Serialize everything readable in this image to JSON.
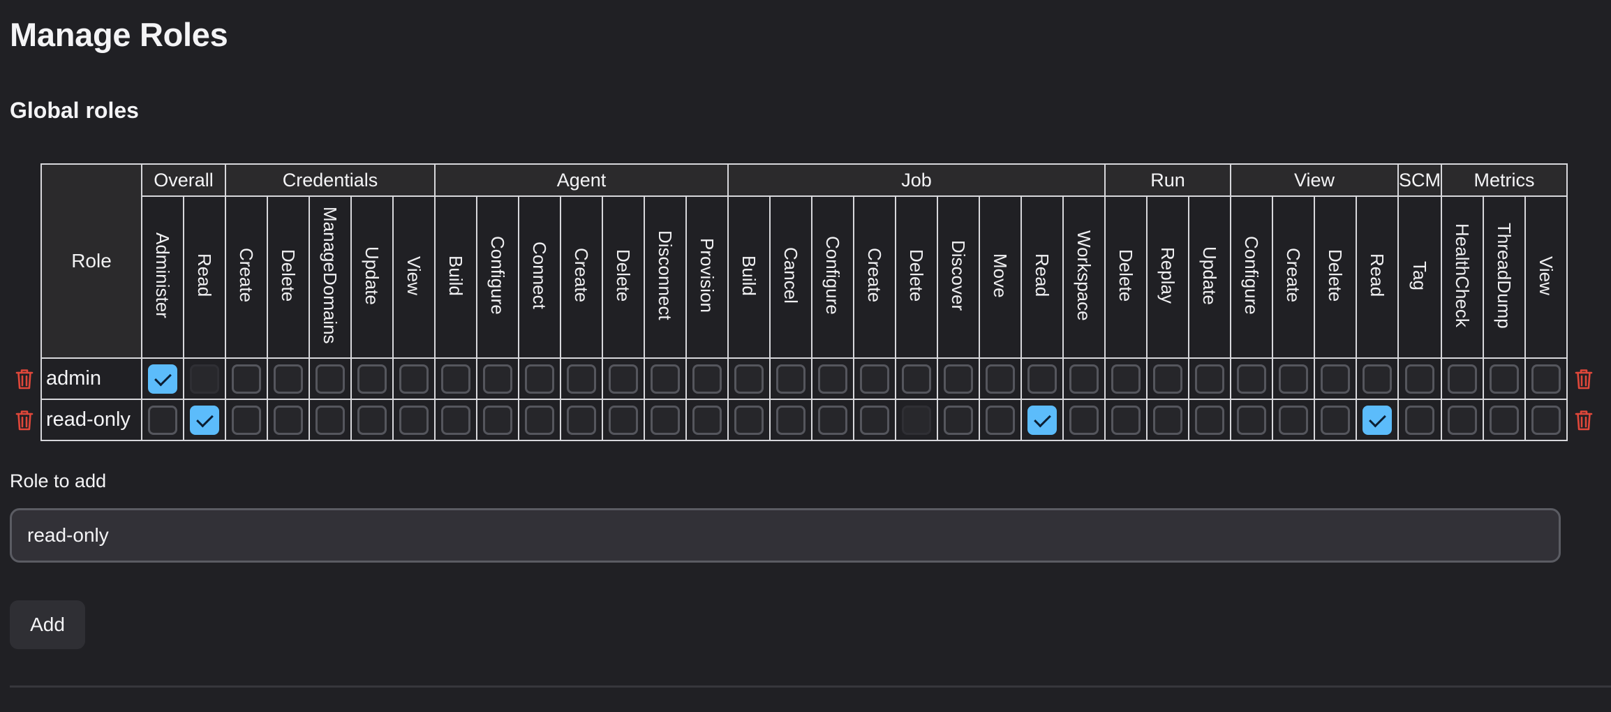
{
  "page": {
    "title": "Manage Roles",
    "section_title": "Global roles"
  },
  "table": {
    "role_header": "Role",
    "groups": [
      {
        "label": "Overall",
        "permissions": [
          "Administer",
          "Read"
        ]
      },
      {
        "label": "Credentials",
        "permissions": [
          "Create",
          "Delete",
          "ManageDomains",
          "Update",
          "View"
        ]
      },
      {
        "label": "Agent",
        "permissions": [
          "Build",
          "Configure",
          "Connect",
          "Create",
          "Delete",
          "Disconnect",
          "Provision"
        ]
      },
      {
        "label": "Job",
        "permissions": [
          "Build",
          "Cancel",
          "Configure",
          "Create",
          "Delete",
          "Discover",
          "Move",
          "Read",
          "Workspace"
        ]
      },
      {
        "label": "Run",
        "permissions": [
          "Delete",
          "Replay",
          "Update"
        ]
      },
      {
        "label": "View",
        "permissions": [
          "Configure",
          "Create",
          "Delete",
          "Read"
        ]
      },
      {
        "label": "SCM",
        "permissions": [
          "Tag"
        ]
      },
      {
        "label": "Metrics",
        "permissions": [
          "HealthCheck",
          "ThreadDump",
          "View"
        ]
      }
    ],
    "rows": [
      {
        "name": "admin",
        "checked": [
          1,
          0,
          0,
          0,
          0,
          0,
          0,
          0,
          0,
          0,
          0,
          0,
          0,
          0,
          0,
          0,
          0,
          0,
          0,
          0,
          0,
          0,
          0,
          0,
          0,
          0,
          0,
          0,
          0,
          0,
          0,
          0,
          0,
          0
        ],
        "dimmed": [
          0,
          1,
          0,
          0,
          0,
          0,
          0,
          0,
          0,
          0,
          0,
          0,
          0,
          0,
          0,
          0,
          0,
          0,
          0,
          0,
          0,
          0,
          0,
          0,
          0,
          0,
          0,
          0,
          0,
          0,
          0,
          0,
          0,
          0
        ]
      },
      {
        "name": "read-only",
        "checked": [
          0,
          1,
          0,
          0,
          0,
          0,
          0,
          0,
          0,
          0,
          0,
          0,
          0,
          0,
          0,
          0,
          0,
          0,
          0,
          0,
          0,
          1,
          0,
          0,
          0,
          0,
          0,
          0,
          0,
          1,
          0,
          0,
          0,
          0
        ],
        "dimmed": [
          0,
          0,
          0,
          0,
          0,
          0,
          0,
          0,
          0,
          0,
          0,
          0,
          0,
          0,
          0,
          0,
          0,
          0,
          1,
          0,
          0,
          0,
          0,
          0,
          0,
          0,
          0,
          0,
          0,
          0,
          0,
          0,
          0,
          0
        ]
      }
    ]
  },
  "add_role": {
    "label": "Role to add",
    "value": "read-only",
    "button_label": "Add"
  },
  "icons": {
    "delete_row": "trash-icon"
  },
  "colors": {
    "background": "#202024",
    "checkbox_checked": "#5cbcfb",
    "trash": "#e0473a",
    "grid_line": "#d8d8dc"
  }
}
